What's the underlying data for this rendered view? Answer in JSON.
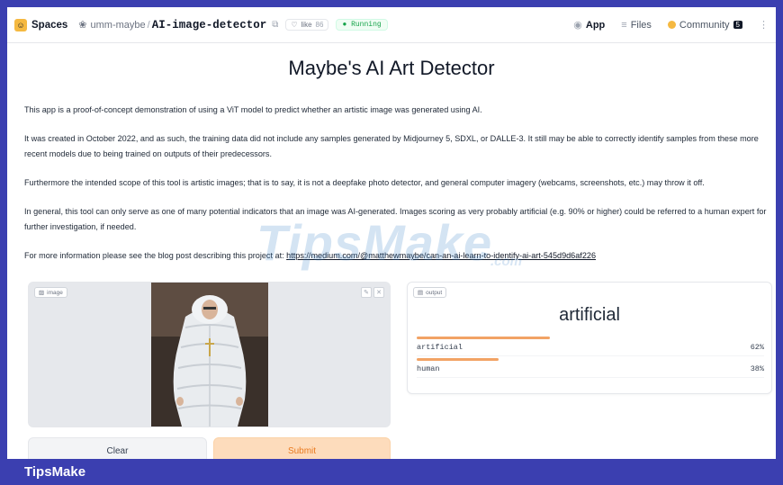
{
  "header": {
    "spaces_label": "Spaces",
    "owner": "umm-maybe",
    "separator": "/",
    "repo": "AI-image-detector",
    "like_label": "like",
    "like_count": "86",
    "status": "Running",
    "tabs": [
      {
        "label": "App",
        "icon": "app-icon"
      },
      {
        "label": "Files",
        "icon": "files-icon"
      },
      {
        "label": "Community",
        "icon": "community-icon",
        "badge": "5"
      }
    ]
  },
  "page": {
    "title": "Maybe's AI Art Detector",
    "paragraphs": [
      "This app is a proof-of-concept demonstration of using a ViT model to predict whether an artistic image was generated using AI.",
      "It was created in October 2022, and as such, the training data did not include any samples generated by Midjourney 5, SDXL, or DALLE-3. It still may be able to correctly identify samples from these more recent models due to being trained on outputs of their predecessors.",
      "Furthermore the intended scope of this tool is artistic images; that is to say, it is not a deepfake photo detector, and general computer imagery (webcams, screenshots, etc.) may throw it off.",
      "In general, this tool can only serve as one of many potential indicators that an image was AI-generated. Images scoring as very probably artificial (e.g. 90% or higher) could be referred to a human expert for further investigation, if needed."
    ],
    "more_info_prefix": "For more information please see the blog post describing this project at: ",
    "more_info_link": "https://medium.com/@matthewmaybe/can-an-ai-learn-to-identify-ai-art-545d9d6af226"
  },
  "image_input": {
    "label": "image",
    "clear_label": "Clear",
    "submit_label": "Submit"
  },
  "output": {
    "label": "output",
    "predicted": "artificial",
    "confidences": [
      {
        "name": "artificial",
        "value": 0.62,
        "text": "62%"
      },
      {
        "name": "human",
        "value": 0.38,
        "text": "38%"
      }
    ]
  },
  "watermark": {
    "text": "TipsMake",
    "suffix": ".com"
  },
  "banner": {
    "text": "TipsMake"
  },
  "colors": {
    "accent": "#f2a365",
    "frame": "#3b3fb0",
    "submit_text": "#ea7b20"
  }
}
